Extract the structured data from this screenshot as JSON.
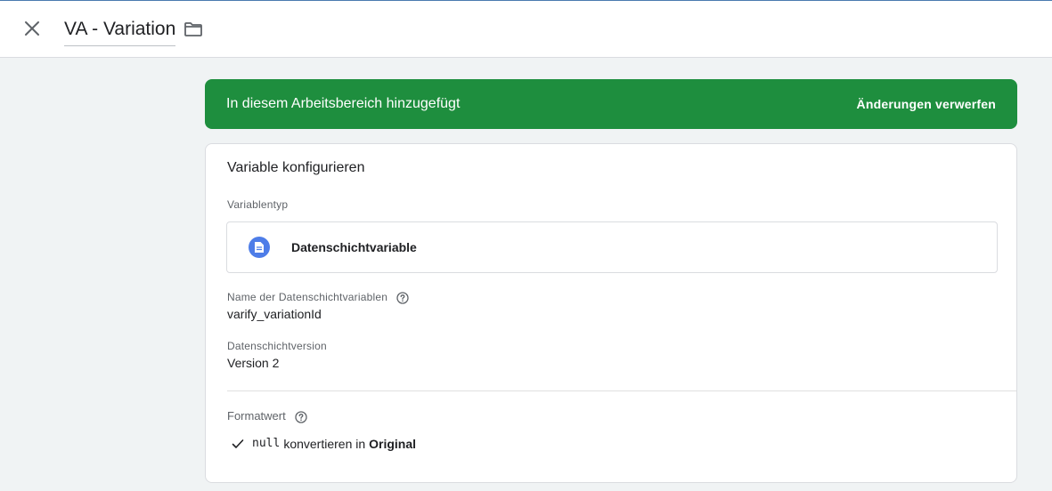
{
  "header": {
    "title": "VA - Variation"
  },
  "banner": {
    "message": "In diesem Arbeitsbereich hinzugefügt",
    "action_label": "Änderungen verwerfen"
  },
  "card": {
    "title": "Variable konfigurieren",
    "variable_type": {
      "label": "Variablentyp",
      "value": "Datenschichtvariable"
    },
    "name_field": {
      "label": "Name der Datenschichtvariablen",
      "value": "varify_variationId"
    },
    "version_field": {
      "label": "Datenschichtversion",
      "value": "Version 2"
    },
    "format": {
      "title": "Formatwert",
      "rule_code": "null",
      "rule_text": "konvertieren in",
      "rule_target": "Original"
    }
  },
  "colors": {
    "banner_bg": "#1e8e3e",
    "type_icon_bg": "#4e7de8",
    "page_bg": "#f0f3f4"
  },
  "icons": [
    "close-icon",
    "folder-icon",
    "document-icon",
    "help-icon",
    "check-icon"
  ]
}
